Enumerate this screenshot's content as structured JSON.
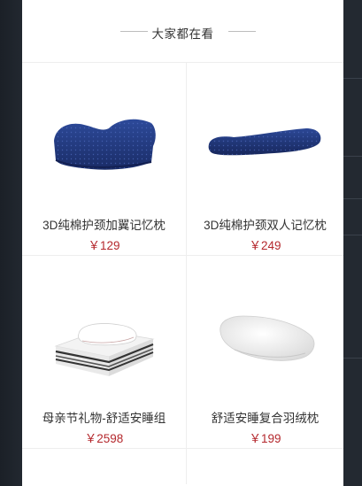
{
  "section": {
    "title": "大家都在看"
  },
  "products": [
    {
      "name": "3D纯棉护颈加翼记忆枕",
      "price": "￥129",
      "image": "navy-contour-memory-pillow"
    },
    {
      "name": "3D纯棉护颈双人记忆枕",
      "price": "￥249",
      "image": "navy-long-double-pillow"
    },
    {
      "name": "母亲节礼物-舒适安睡组",
      "price": "￥2598",
      "image": "mattress-with-pillow-set"
    },
    {
      "name": "舒适安睡复合羽绒枕",
      "price": "￥199",
      "image": "white-down-pillow"
    }
  ],
  "colors": {
    "price": "#b4282d",
    "text": "#333333",
    "divider": "#eeeeee",
    "backdrop": "#20252d"
  }
}
